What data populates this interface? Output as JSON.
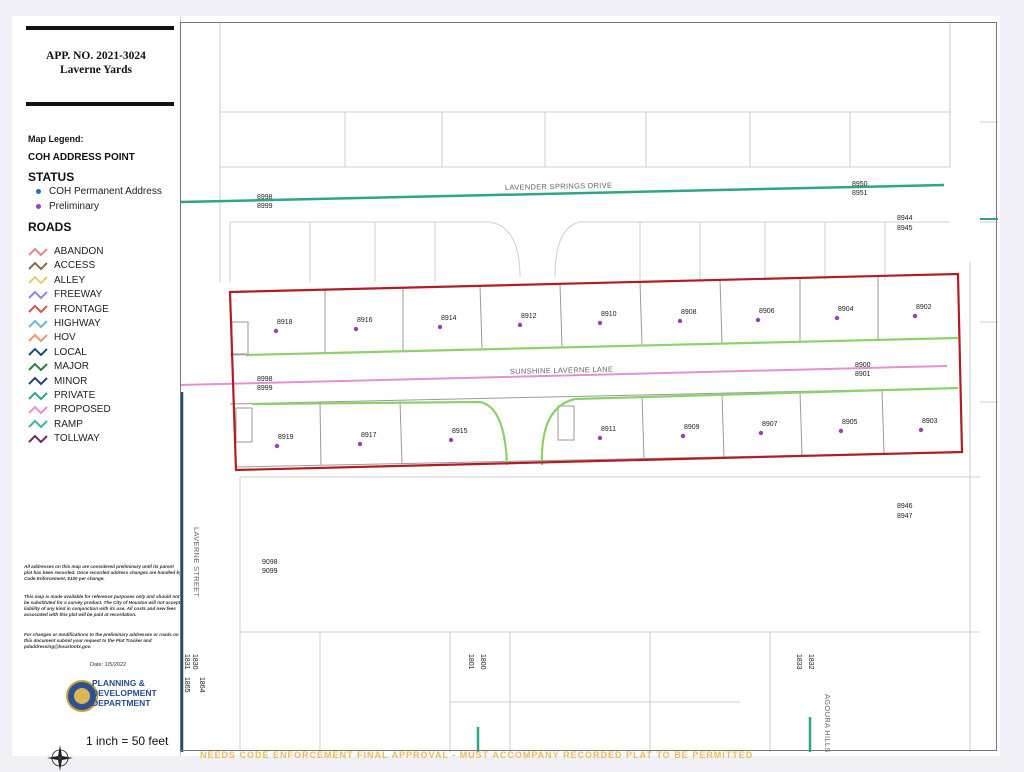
{
  "legend": {
    "app_no": "APP. NO. 2021-3024",
    "app_name": "Laverne Yards",
    "map_legend": "Map Legend:",
    "coh_heading": "COH ADDRESS POINT",
    "status_heading": "STATUS",
    "status_items": [
      {
        "label": "COH Permanent Address",
        "color": "#1f6fb5"
      },
      {
        "label": "Preliminary",
        "color": "#9b3fb5"
      }
    ],
    "roads_heading": "ROADS",
    "roads": [
      {
        "label": "ABANDON",
        "color": "#d98a8a"
      },
      {
        "label": "ACCESS",
        "color": "#8a6d4e"
      },
      {
        "label": "ALLEY",
        "color": "#d4d46a"
      },
      {
        "label": "FREEWAY",
        "color": "#8a8ad9"
      },
      {
        "label": "FRONTAGE",
        "color": "#d9534f"
      },
      {
        "label": "HIGHWAY",
        "color": "#6fb7d4"
      },
      {
        "label": "HOV",
        "color": "#e89a6a"
      },
      {
        "label": "LOCAL",
        "color": "#1d4f6e"
      },
      {
        "label": "MAJOR",
        "color": "#2e7d52"
      },
      {
        "label": "MINOR",
        "color": "#2a3f7a"
      },
      {
        "label": "PRIVATE",
        "color": "#2ea58a"
      },
      {
        "label": "PROPOSED",
        "color": "#e58fd4"
      },
      {
        "label": "RAMP",
        "color": "#3fb59a"
      },
      {
        "label": "TOLLWAY",
        "color": "#6a2a5a"
      }
    ],
    "note1": "All addresses on this map are considered preliminary until its parent plat has been recorded. Once recorded address changes are handled by Code Enforcement, $100 per change.",
    "note2": "This map is made available for reference purposes only and should not be substituted for a survey product. The City of Houston will not accept liability of any kind in conjunction with its use. All costs and new fees associated with this plat will be paid at recordation.",
    "note3": "For changes or modifications to the preliminary addresses or roads on this document submit your request to the Plat Tracker and pdaddressing@houstontx.gov.",
    "date": "Date: 1/5/2022",
    "dept_line1": "PLANNING &",
    "dept_line2": "DEVELOPMENT",
    "dept_line3": "DEPARTMENT",
    "scale": "1 inch = 50 feet"
  },
  "map": {
    "street_top": "LAVENDER SPRINGS DRIVE",
    "street_mid": "SUNSHINE LAVERNE LANE",
    "street_left": "LAVERNE STREET",
    "street_bottom": "AGOURA HILLS DRIVE",
    "top_north_lots": [
      "8918",
      "8916",
      "8914",
      "8912",
      "8910",
      "8908",
      "8906",
      "8904",
      "8902"
    ],
    "bottom_south_lots": [
      "8919",
      "8917",
      "8915",
      "8911",
      "8909",
      "8907",
      "8905",
      "8903"
    ],
    "range_labels": {
      "top_left_a": "8998",
      "top_left_b": "8999",
      "top_right_a": "8950",
      "top_right_b": "8951",
      "right_a": "8944",
      "right_b": "8945",
      "mid_left_a": "8998",
      "mid_left_b": "8999",
      "mid_right_a": "8900",
      "mid_right_b": "8901",
      "low_right_a": "8946",
      "low_right_b": "8947",
      "low_left_a": "9098",
      "low_left_b": "9099",
      "bottom_a": "1830",
      "bottom_b": "1831",
      "bottom_c": "1864",
      "bottom_d": "1865",
      "bottom_e": "1800",
      "bottom_f": "1801",
      "bottom_g": "1832",
      "bottom_h": "1833"
    },
    "footer_text": "NEEDS CODE ENFORCEMENT FINAL APPROVAL - MUST ACCOMPANY RECORDED PLAT TO BE PERMITTED"
  }
}
